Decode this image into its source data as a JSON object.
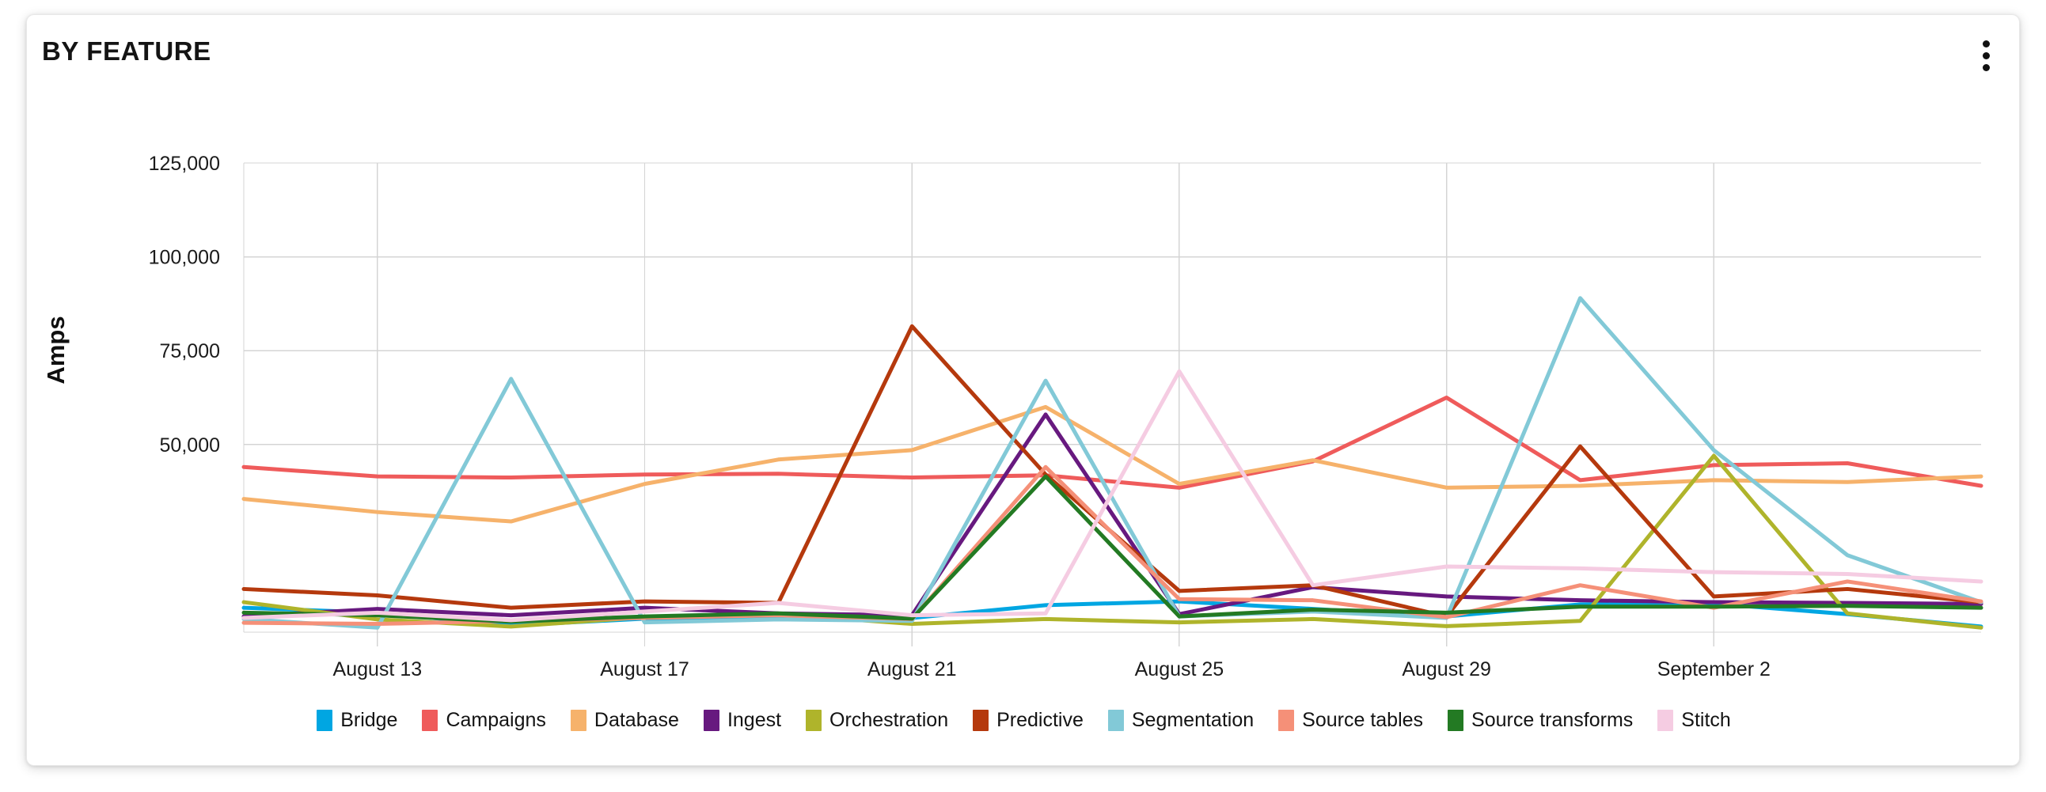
{
  "card": {
    "title": "BY FEATURE",
    "menu_icon": "vertical-ellipsis-icon"
  },
  "chart_data": {
    "type": "line",
    "title": "BY FEATURE",
    "xlabel": "",
    "ylabel": "Amps",
    "ylim": [
      0,
      125000
    ],
    "grid": true,
    "legend_position": "bottom",
    "y_ticks": [
      "50,000",
      "75,000",
      "100,000",
      "125,000"
    ],
    "y_tick_values": [
      50000,
      75000,
      100000,
      125000
    ],
    "x_ticks": [
      "August 13",
      "August 17",
      "August 21",
      "August 25",
      "August 29",
      "September 2"
    ],
    "x_tick_indices": [
      1,
      3,
      5,
      7,
      9,
      11
    ],
    "x": [
      "August 11",
      "August 13",
      "August 15",
      "August 17",
      "August 19",
      "August 21",
      "August 23",
      "August 25",
      "August 27",
      "August 29",
      "August 31",
      "September 2",
      "September 4",
      "September 6"
    ],
    "series": [
      {
        "name": "Bridge",
        "color": "#00A6E2",
        "values": [
          6500,
          5200,
          1800,
          3600,
          4200,
          3800,
          7200,
          8200,
          6200,
          4200,
          7400,
          7600,
          4800,
          1500
        ]
      },
      {
        "name": "Campaigns",
        "color": "#EF5B5B",
        "values": [
          44000,
          41500,
          41200,
          42000,
          42200,
          41200,
          41800,
          38500,
          45500,
          62500,
          40500,
          44500,
          45000,
          39000
        ]
      },
      {
        "name": "Database",
        "color": "#F6B26B",
        "values": [
          35500,
          32000,
          29500,
          39500,
          46000,
          48500,
          60000,
          39500,
          45800,
          38500,
          39000,
          40500,
          40000,
          41500
        ]
      },
      {
        "name": "Ingest",
        "color": "#67197F",
        "values": [
          4200,
          6200,
          4500,
          6500,
          5000,
          4500,
          58000,
          4800,
          12000,
          9500,
          8500,
          8000,
          7800,
          7500
        ]
      },
      {
        "name": "Orchestration",
        "color": "#AFB42B",
        "values": [
          8000,
          3400,
          1500,
          4000,
          4800,
          2200,
          3500,
          2600,
          3500,
          1600,
          3000,
          47000,
          5000,
          1200
        ]
      },
      {
        "name": "Predictive",
        "color": "#B5390D",
        "values": [
          11500,
          9800,
          6500,
          8200,
          7800,
          81500,
          42000,
          11000,
          12500,
          4200,
          49500,
          9500,
          11500,
          8000
        ]
      },
      {
        "name": "Segmentation",
        "color": "#82C9D7",
        "values": [
          3500,
          1200,
          67500,
          2600,
          3400,
          3000,
          67000,
          4200,
          5500,
          3800,
          89000,
          48500,
          20500,
          8000
        ]
      },
      {
        "name": "Source tables",
        "color": "#F59078",
        "values": [
          2500,
          2200,
          3000,
          3800,
          4500,
          3500,
          44000,
          8800,
          8500,
          4000,
          12500,
          6500,
          13500,
          8200
        ]
      },
      {
        "name": "Source transforms",
        "color": "#237A23",
        "values": [
          5200,
          4500,
          2800,
          4200,
          5000,
          3600,
          41500,
          4200,
          6000,
          5200,
          6800,
          6800,
          7000,
          6500
        ]
      },
      {
        "name": "Stitch",
        "color": "#F5CCE2",
        "values": [
          3800,
          5200,
          3200,
          5500,
          7800,
          4500,
          5000,
          69500,
          12500,
          17500,
          17000,
          16000,
          15500,
          13500
        ]
      }
    ]
  },
  "legend": {
    "items": [
      {
        "label": "Bridge",
        "color": "#00A6E2"
      },
      {
        "label": "Campaigns",
        "color": "#EF5B5B"
      },
      {
        "label": "Database",
        "color": "#F6B26B"
      },
      {
        "label": "Ingest",
        "color": "#67197F"
      },
      {
        "label": "Orchestration",
        "color": "#AFB42B"
      },
      {
        "label": "Predictive",
        "color": "#B5390D"
      },
      {
        "label": "Segmentation",
        "color": "#82C9D7"
      },
      {
        "label": "Source tables",
        "color": "#F59078"
      },
      {
        "label": "Source transforms",
        "color": "#237A23"
      },
      {
        "label": "Stitch",
        "color": "#F5CCE2"
      }
    ]
  }
}
